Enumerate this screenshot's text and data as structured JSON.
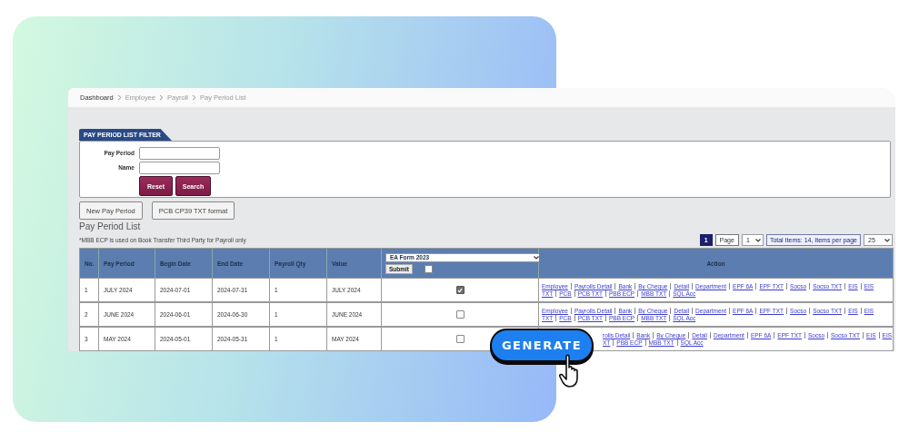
{
  "breadcrumb": [
    "Dashboard",
    "Employee",
    "Payroll",
    "Pay Period List"
  ],
  "filter": {
    "tab": "PAY PERIOD LIST FILTER",
    "fields": [
      {
        "label": "Pay Period"
      },
      {
        "label": "Name"
      }
    ],
    "buttons": [
      "Reset",
      "Search"
    ]
  },
  "actions": [
    "New Pay Period",
    "PCB CP39 TXT format"
  ],
  "list": {
    "title": "Pay Period List",
    "note": "*MBB ECP is used on Book Transfer Third Party for Payroll only"
  },
  "pagination": {
    "pages": [
      {
        "label": "1",
        "selected": true
      }
    ],
    "page_label": "Page",
    "page_select": "1",
    "total": "Total Items: 14, Items per page",
    "per_page": "25"
  },
  "table": {
    "columns": [
      "No.",
      "Pay Period",
      "Begin Date",
      "End Date",
      "Payroll Qty",
      "Value"
    ],
    "form_select": "EA Form 2023",
    "submit": "Submit",
    "select_all": false,
    "action_header": "Action",
    "rows": [
      {
        "no": "1",
        "pay_period": "JULY 2024",
        "begin_date": "2024-07-01",
        "end_date": "2024-07-31",
        "payroll_qty": "1",
        "value": "JULY 2024",
        "checked": true,
        "action_lines": [
          [
            "Employee",
            "Payrolls Detail",
            "Bank",
            "By Cheque",
            "Detail",
            "Department",
            "EPF 6A",
            "EPF TXT",
            "Socso",
            "Socso TXT",
            "EIS",
            "EIS"
          ],
          [
            "TXT",
            "PCB",
            "PCB TXT",
            "PBB ECP",
            "MBB TXT",
            "SQL Acc"
          ]
        ]
      },
      {
        "no": "2",
        "pay_period": "JUNE 2024",
        "begin_date": "2024-06-01",
        "end_date": "2024-06-30",
        "payroll_qty": "1",
        "value": "JUNE 2024",
        "checked": false,
        "action_lines": [
          [
            "Employee",
            "Payrolls Detail",
            "Bank",
            "By Cheque",
            "Detail",
            "Department",
            "EPF 6A",
            "EPF TXT",
            "Socso",
            "Socso TXT",
            "EIS",
            "EIS"
          ],
          [
            "TXT",
            "PCB",
            "PCB TXT",
            "PBB ECP",
            "MBB TXT",
            "SQL Acc"
          ]
        ]
      },
      {
        "no": "3",
        "pay_period": "MAY 2024",
        "begin_date": "2024-05-01",
        "end_date": "2024-05-31",
        "payroll_qty": "1",
        "value": "MAY 2024",
        "checked": false,
        "action_lines": [
          [
            "rolls Detail",
            "Bank",
            "By Cheque",
            "Detail",
            "Department",
            "EPF 6A",
            "EPF TXT",
            "Socso",
            "Socso TXT",
            "EIS",
            "EIS"
          ],
          [
            "XT",
            "PBB ECP",
            "MBB TXT",
            "SQL Acc"
          ]
        ]
      }
    ]
  },
  "generate_button": {
    "label": "GENERATE"
  }
}
